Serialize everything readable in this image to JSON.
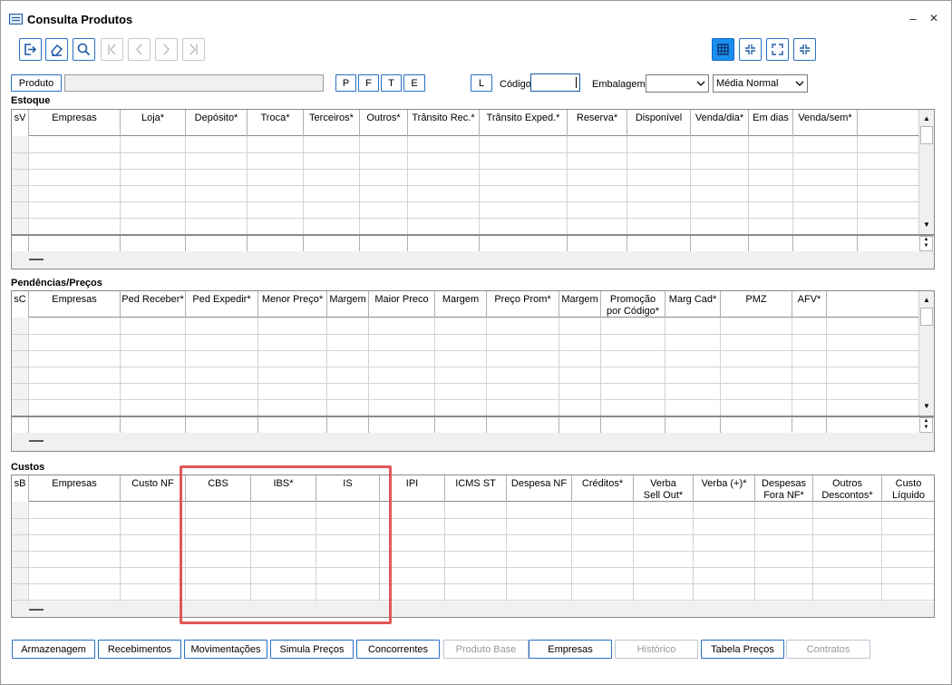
{
  "window": {
    "title": "Consulta Produtos",
    "minimize": "–",
    "close": "✕"
  },
  "toolbar": {
    "icons": [
      "exit-icon",
      "eraser-icon",
      "search-icon",
      "first-icon",
      "prev-icon",
      "next-icon",
      "last-icon"
    ],
    "view_icons": [
      "grid-view-icon",
      "collapse-icon",
      "expand-icon",
      "collapse-alt-icon"
    ]
  },
  "product_bar": {
    "produto_label": "Produto",
    "filters": [
      "P",
      "F",
      "T",
      "E"
    ],
    "l_label": "L",
    "codigo_label": "Código",
    "codigo_value": "",
    "embalagem_label": "Embalagem",
    "embalagem_value": "",
    "media_value": "Média Normal"
  },
  "estoque": {
    "title": "Estoque",
    "columns": [
      "sV",
      "Empresas",
      "Loja*",
      "Depósito*",
      "Troca*",
      "Terceiros*",
      "Outros*",
      "Trânsito Rec.*",
      "Trânsito Exped.*",
      "Reserva*",
      "Disponível",
      "Venda/dia*",
      "Em dias",
      "Venda/sem*"
    ]
  },
  "pendencias": {
    "title": "Pendências/Preços",
    "columns": [
      "sC",
      "Empresas",
      "Ped Receber*",
      "Ped Expedir*",
      "Menor Preço*",
      "Margem",
      "Maior Preco",
      "Margem",
      "Preço Prom*",
      "Margem",
      "Promoção\npor Código*",
      "Marg Cad*",
      "PMZ",
      "AFV*"
    ]
  },
  "custos": {
    "title": "Custos",
    "columns": [
      "sB",
      "Empresas",
      "Custo NF",
      "CBS",
      "IBS*",
      "IS",
      "IPI",
      "ICMS ST",
      "Despesa NF",
      "Créditos*",
      "Verba\nSell Out*",
      "Verba (+)*",
      "Despesas\nFora NF*",
      "Outros\nDescontos*",
      "Custo\nLíquido"
    ]
  },
  "bottom_buttons": [
    {
      "label": "Armazenagem",
      "enabled": true
    },
    {
      "label": "Recebimentos",
      "enabled": true
    },
    {
      "label": "Movimentações",
      "enabled": true
    },
    {
      "label": "Simula Preços",
      "enabled": true
    },
    {
      "label": "Concorrentes",
      "enabled": true
    },
    {
      "label": "Produto Base",
      "enabled": false
    },
    {
      "label": "Empresas",
      "enabled": true
    },
    {
      "label": "Histórico",
      "enabled": false
    },
    {
      "label": "Tabela Preços",
      "enabled": true
    },
    {
      "label": "Contratos",
      "enabled": false
    }
  ],
  "colors": {
    "accent": "#2a6fc2",
    "active": "#1b8ff0",
    "highlight": "#e05757"
  }
}
